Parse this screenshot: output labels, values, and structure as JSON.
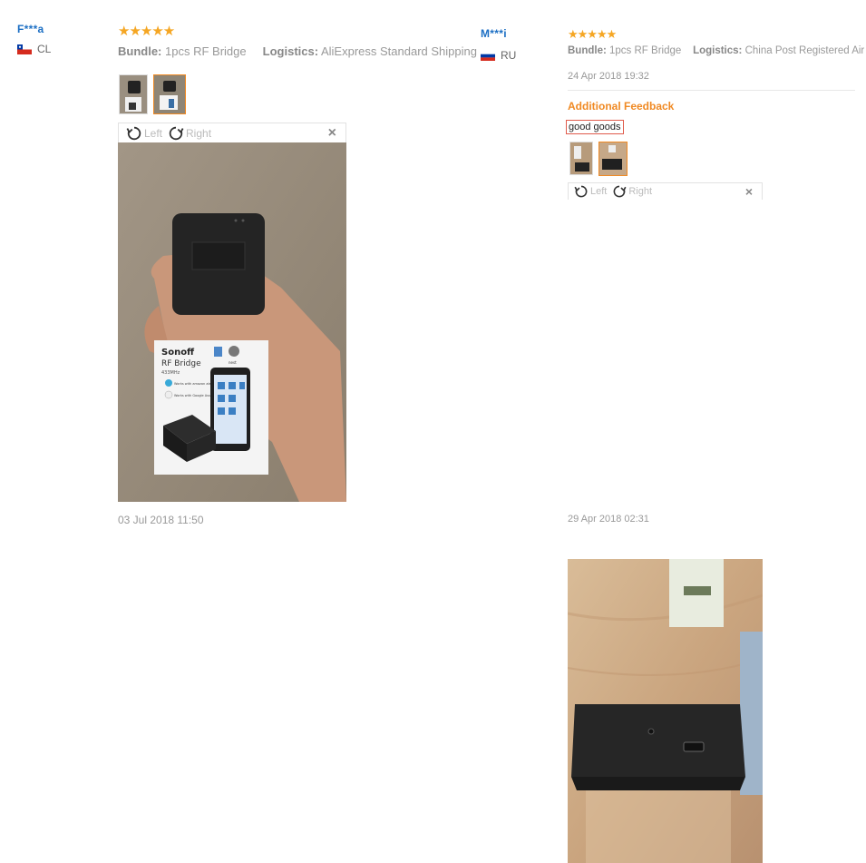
{
  "reviews": [
    {
      "user": "F***a",
      "country": "CL",
      "stars": "★★★★★",
      "bundle_label": "Bundle:",
      "bundle_value": "1pcs RF Bridge",
      "logistics_label": "Logistics:",
      "logistics_value": "AliExpress Standard Shipping",
      "rotate_left": "Left",
      "rotate_right": "Right",
      "close": "×",
      "date": "03 Jul 2018 11:50",
      "photo_text": {
        "brand": "Sonoff",
        "product": "RF Bridge",
        "freq": "433MHz",
        "badge1": "Works with amazon alexa",
        "badge2": "Works with Google Assistant",
        "badge3": "nest"
      }
    },
    {
      "user": "M***i",
      "country": "RU",
      "stars": "★★★★★",
      "bundle_label": "Bundle:",
      "bundle_value": "1pcs RF Bridge",
      "logistics_label": "Logistics:",
      "logistics_value": "China Post Registered Air Mail",
      "date_top": "24 Apr 2018 19:32",
      "additional_feedback_title": "Additional Feedback",
      "additional_feedback_text": "good goods",
      "rotate_left": "Left",
      "rotate_right": "Right",
      "close": "×",
      "date": "29 Apr 2018 02:31"
    }
  ],
  "colors": {
    "accent": "#f08a24",
    "link": "#1c6fc4",
    "star": "#f5a623"
  }
}
